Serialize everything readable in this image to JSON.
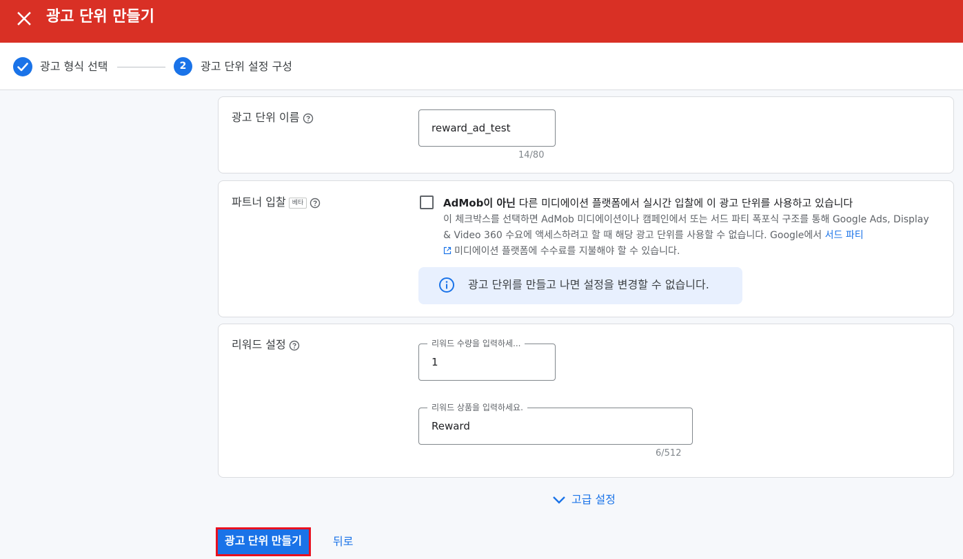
{
  "header": {
    "title": "광고 단위 만들기",
    "close_icon": "close-icon",
    "background_color": "#d93025"
  },
  "stepper": {
    "steps": [
      {
        "label": "광고 형식 선택",
        "state": "completed",
        "icon": "check-circle-icon"
      },
      {
        "number": "2",
        "label": "광고 단위 설정 구성",
        "state": "active"
      }
    ]
  },
  "ad_unit_name": {
    "label": "광고 단위 이름",
    "value": "reward_ad_test",
    "counter": "14/80"
  },
  "partner_bidding": {
    "label": "파트너 입찰",
    "beta_badge": "베타",
    "checkbox_checked": false,
    "checkbox_title_bold": "AdMob이 아닌",
    "checkbox_title_rest": " 다른 미디에이션 플랫폼에서 실시간 입찰에 이 광고 단위를 사용하고 있습니다",
    "description_part1": "이 체크박스를 선택하면 AdMob 미디에이션이나 캠페인에서 또는 서드 파티 폭포식 구조를 통해 Google Ads, Display & Video 360 수요에 액세스하려고 할 때 해당 광고 단위를 사용할 수 없습니다. Google에서 ",
    "description_link": "서드 파티",
    "description_part2": "미디에이션 플랫폼에 수수료를 지불해야 할 수 있습니다.",
    "info_message": "광고 단위를 만들고 나면 설정을 변경할 수 없습니다."
  },
  "reward_settings": {
    "label": "리워드 설정",
    "amount_label": "리워드 수량을 입력하세...",
    "amount_value": "1",
    "item_label": "리워드 상품을 입력하세요.",
    "item_value": "Reward",
    "item_counter": "6/512"
  },
  "advanced_settings": {
    "label": "고급 설정",
    "icon": "chevron-down-icon"
  },
  "actions": {
    "create_label": "광고 단위 만들기",
    "back_label": "뒤로"
  },
  "colors": {
    "primary": "#1a73e8",
    "highlight_border": "#e8101f",
    "info_background": "#e8f0fe"
  }
}
